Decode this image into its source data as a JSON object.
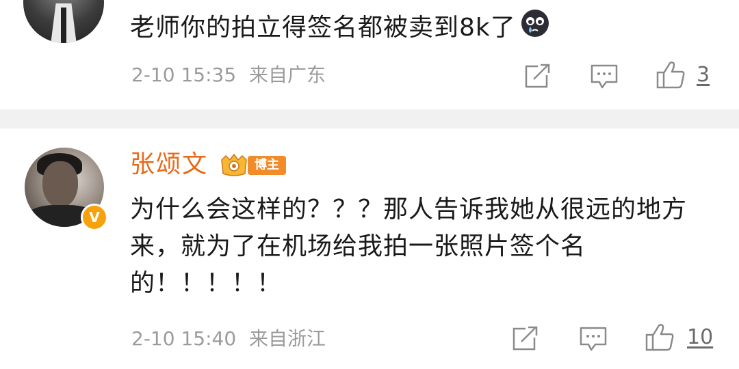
{
  "comments": [
    {
      "text": "老师你的拍立得签名都被卖到8k了",
      "emoji": "crying-emoji",
      "time": "2-10 15:35",
      "location": "来自广东",
      "likes": "3"
    },
    {
      "username": "张颂文",
      "badge_label": "博主",
      "verified_mark": "V",
      "text": "为什么会这样的？？？那人告诉我她从很远的地方来，就为了在机场给我拍一张照片签个名的！！！！！",
      "time": "2-10 15:40",
      "location": "来自浙江",
      "likes": "10"
    }
  ],
  "colors": {
    "username": "#e86a1b",
    "badge": "#f28c28",
    "verified": "#f7a20c",
    "meta": "#9b9b9b",
    "divider": "#f1f1f1"
  },
  "icons": [
    "share-icon",
    "comment-icon",
    "like-icon"
  ]
}
